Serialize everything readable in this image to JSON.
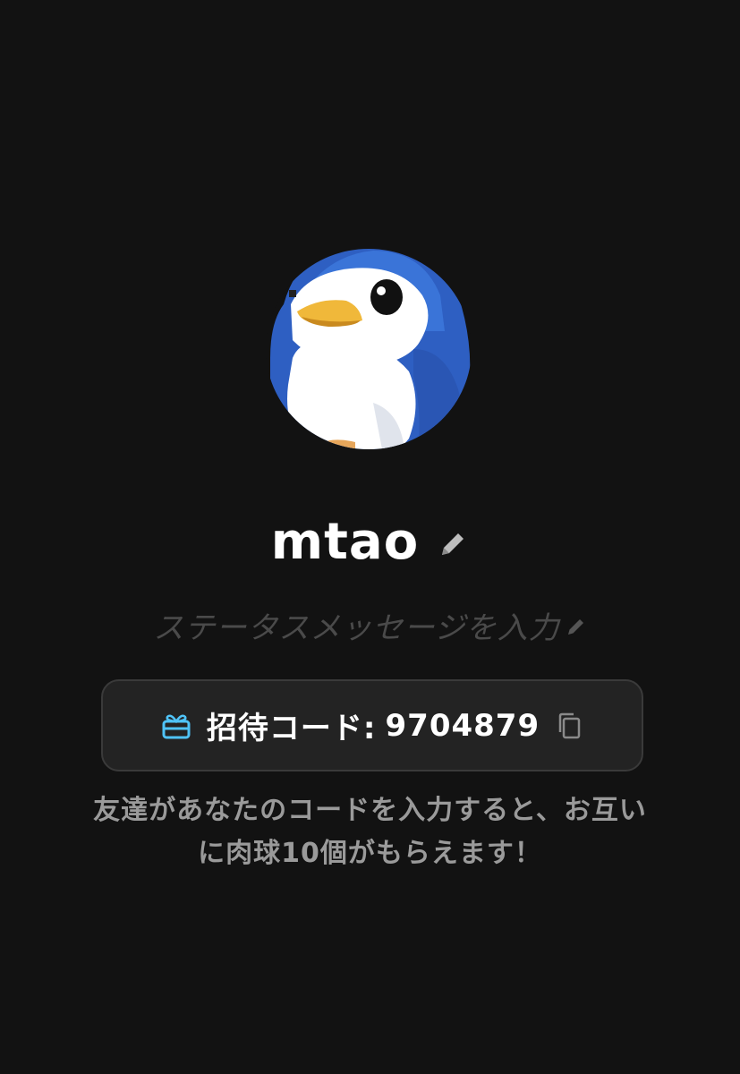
{
  "profile": {
    "username": "mtao",
    "status_placeholder": "ステータスメッセージを入力",
    "avatar_icon": "penguin-avatar-icon"
  },
  "invite": {
    "label": "招待コード:",
    "code": "9704879",
    "gift_icon": "gift-icon",
    "copy_icon": "copy-icon",
    "accent_color": "#4fc3f7"
  },
  "description": {
    "line1": "友達があなたのコードを入力すると、お互い",
    "line2": "に肉球10個がもらえます！"
  },
  "colors": {
    "background": "#121212",
    "card": "#232323",
    "muted_text": "#9a9a9a",
    "placeholder_text": "#4a4a4a"
  }
}
